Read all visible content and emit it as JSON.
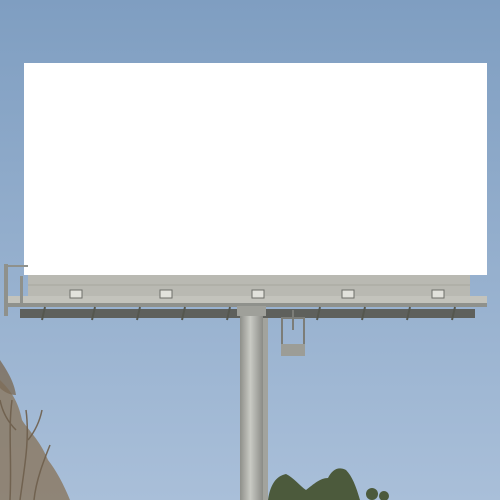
{
  "scene": {
    "description_items": [
      "sky",
      "billboard-panel",
      "catwalk",
      "pole",
      "service-box",
      "tree-left",
      "trees-bottom"
    ]
  },
  "colors": {
    "sky_top": "#7f9ec1",
    "sky_bottom": "#a9bfd9",
    "panel": "#ffffff",
    "frame": "#b9b9b2",
    "steel": "#8f918c",
    "pole": "#b7b8b2",
    "tree_left": "#7c6c58",
    "trees": "#4c5a3c"
  }
}
